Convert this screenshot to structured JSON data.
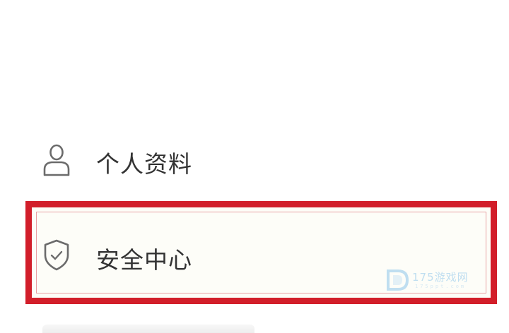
{
  "menu": {
    "items": [
      {
        "label": "个人资料",
        "icon": "user-icon"
      },
      {
        "label": "安全中心",
        "icon": "shield-check-icon",
        "highlighted": true
      }
    ]
  },
  "watermark": {
    "text": "175游戏网",
    "sub": "175ppt.com"
  },
  "colors": {
    "highlight_border": "#d21e2a",
    "label_text": "#333333",
    "icon_stroke": "#6b6b6b"
  }
}
